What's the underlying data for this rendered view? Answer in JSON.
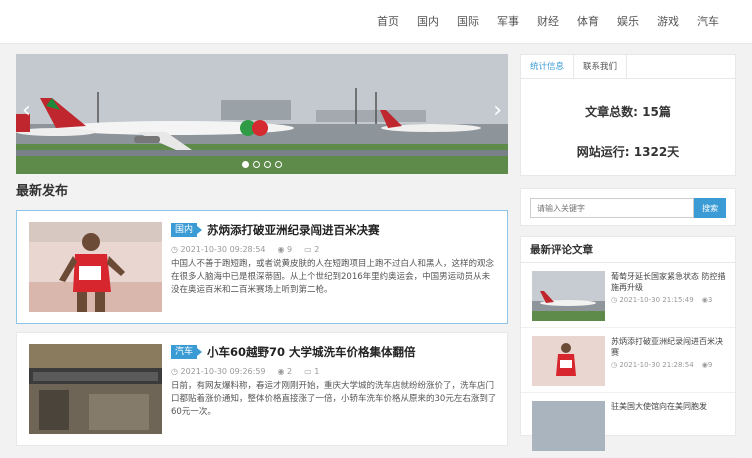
{
  "nav": [
    "首页",
    "国内",
    "国际",
    "军事",
    "财经",
    "体育",
    "娱乐",
    "游戏",
    "汽车"
  ],
  "slider": {
    "dots": 4,
    "active": 0
  },
  "latest_title": "最新发布",
  "articles": [
    {
      "tag": "国内",
      "title": "苏炳添打破亚洲纪录闯进百米决赛",
      "date": "2021-10-30 09:28:54",
      "views": "9",
      "comments": "2",
      "excerpt": "中国人不善于跑短跑，或者说黄皮肤的人在短跑项目上跑不过白人和黑人，这样的观念在很多人脑海中已是根深蒂固。从上个世纪到2016年里约奥运会，中国男运动员从未没在奥运百米和二百米赛场上听到第二枪。"
    },
    {
      "tag": "汽车",
      "title": "小车60越野70 大学城洗车价格集体翻倍",
      "date": "2021-10-30 09:26:59",
      "views": "2",
      "comments": "1",
      "excerpt": "日前，有网友爆料称，春运才刚刚开始，重庆大学城的洗车店就纷纷涨价了，洗车店门口都贴着涨价通知，整体价格直接涨了一倍，小轿车洗车价格从原来的30元左右涨到了60元一次。"
    }
  ],
  "stats": {
    "tab_active": "统计信息",
    "tab_other": "联系我们",
    "total_label": "文章总数: 15篇",
    "run_label": "网站运行: 1322天"
  },
  "search": {
    "placeholder": "请输入关键字",
    "button": "搜索"
  },
  "comments": {
    "title": "最新评论文章",
    "items": [
      {
        "text": "葡萄牙延长国家紧急状态 防控措施再升级",
        "date": "2021-10-30 21:15:49",
        "count": "3"
      },
      {
        "text": "苏炳添打破亚洲纪录闯进百米决赛",
        "date": "2021-10-30 21:28:54",
        "count": "9"
      },
      {
        "text": "驻美国大使馆向在美同胞发"
      }
    ]
  },
  "colors": {
    "accent": "#3a9bd5",
    "tag_red": "#d9262c"
  }
}
